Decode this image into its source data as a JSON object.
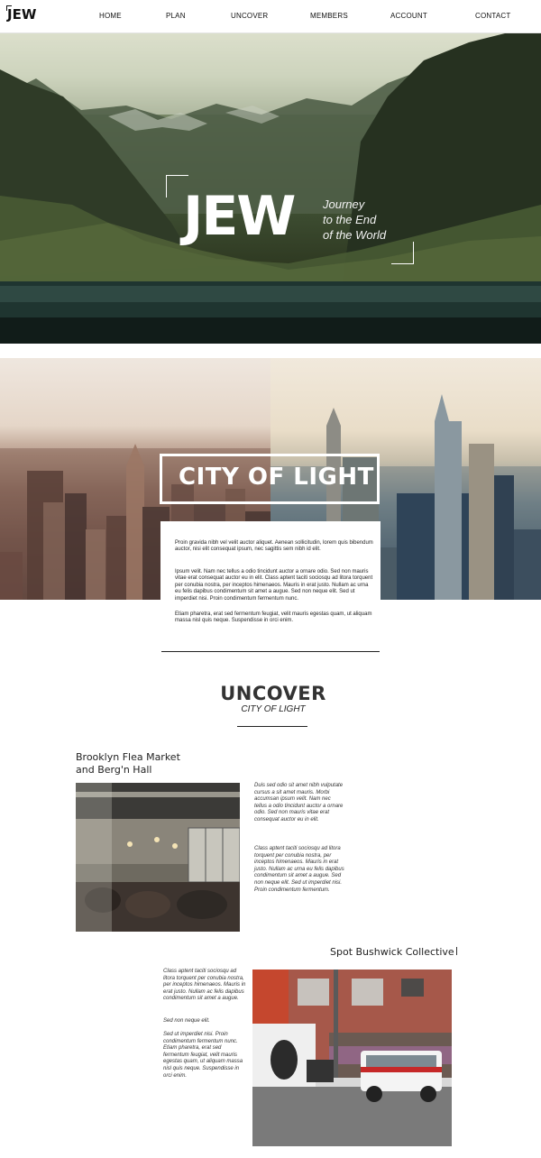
{
  "nav": {
    "logo": "JEW",
    "items": [
      "HOME",
      "PLAN",
      "UNCOVER",
      "MEMBERS",
      "ACCOUNT",
      "CONTACT"
    ]
  },
  "hero": {
    "logo": "JEW",
    "tagline": [
      "Journey",
      "to the End",
      "of the World"
    ]
  },
  "city": {
    "title": "CITY OF LIGHT",
    "paragraphs": [
      "Proin gravida nibh vel velit auctor aliquet. Aenean sollicitudin, lorem quis bibendum auctor, nisi elit consequat ipsum, nec sagittis sem nibh id elit.",
      "Ipsum velit. Nam nec tellus a odio tincidunt auctor a ornare odio. Sed non mauris vitae erat consequat auctor eu in elit. Class aptent taciti sociosqu ad litora torquent per conubia nostra, per inceptos himenaeos. Mauris in erat justo. Nullam ac urna eu felis dapibus condimentum sit amet a augue. Sed non neque elit. Sed ut imperdiet nisi. Proin condimentum fermentum nunc.",
      "Etiam pharetra, erat sed fermentum feugiat, velit mauris egestas quam, ut aliquam massa nisl quis neque. Suspendisse in orci enim."
    ]
  },
  "uncover": {
    "title": "UNCOVER",
    "subtitle": "CITY OF LIGHT",
    "places": [
      {
        "title_lines": [
          "Brooklyn Flea Market",
          "and Berg'n Hall"
        ],
        "paragraphs": [
          "Duis sed odio sit amet nibh vulputate cursus a sit amet mauris. Morbi accumsan ipsum velit. Nam nec tellus a odio tincidunt auctor a ornare odio. Sed non mauris vitae erat consequat auctor eu in elit.",
          "Class aptent taciti sociosqu ad litora torquent per conubia nostra, per inceptos himenaeos. Mauris in erat justo. Nullam ac urna eu felis dapibus condimentum sit amet a augue. Sed non neque elit. Sed ut imperdiet nisi. Proin condimentum fermentum."
        ]
      },
      {
        "title_lines": [
          "Spot Bushwick Collective"
        ],
        "paragraphs": [
          "Class aptent taciti sociosqu ad litora torquent per conubia nostra, per inceptos himenaeos. Mauris in erat justo. Nullam ac felis dapibus condimentum sit amet a augue.",
          "Sed non neque elit.",
          "Sed ut imperdiet nisi. Proin condimentum fermentum nunc. Etiam pharetra, erat sed fermentum feugiat, velit mauris egestas quam, ut aliquam massa nisl quis neque. Suspendisse in orci enim."
        ]
      }
    ]
  },
  "colors": {
    "accent_dark": "#222222",
    "background": "#ffffff"
  }
}
